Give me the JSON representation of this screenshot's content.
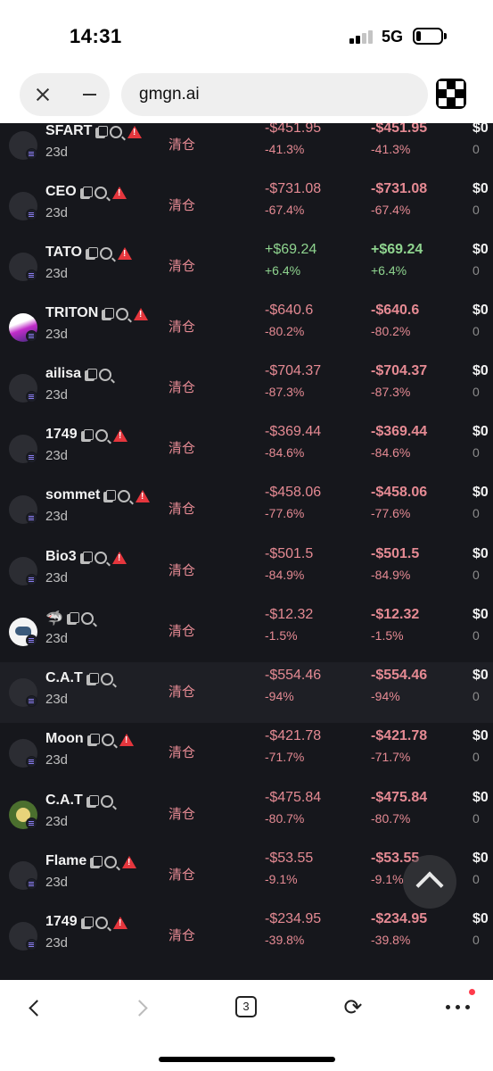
{
  "status_bar": {
    "time": "14:31",
    "network": "5G",
    "battery_level": 0.2
  },
  "browser": {
    "url": "gmgn.ai",
    "tab_count": "3"
  },
  "rows": [
    {
      "name": "SFART",
      "age": "23d",
      "type": "清仓",
      "pnl": "-$451.95",
      "pnl_pct": "-41.3%",
      "pnl2": "-$451.95",
      "pnl2_pct": "-41.3%",
      "extra": "$0",
      "extra_sub": "0",
      "warn": true,
      "avatar": "default"
    },
    {
      "name": "CEO",
      "age": "23d",
      "type": "清仓",
      "pnl": "-$731.08",
      "pnl_pct": "-67.4%",
      "pnl2": "-$731.08",
      "pnl2_pct": "-67.4%",
      "extra": "$0",
      "extra_sub": "0",
      "warn": true,
      "avatar": "default"
    },
    {
      "name": "TATO",
      "age": "23d",
      "type": "清仓",
      "pnl": "+$69.24",
      "pnl_pct": "+6.4%",
      "pnl2": "+$69.24",
      "pnl2_pct": "+6.4%",
      "extra": "$0",
      "extra_sub": "0",
      "warn": true,
      "avatar": "default",
      "positive": true
    },
    {
      "name": "TRITON",
      "age": "23d",
      "type": "清仓",
      "pnl": "-$640.6",
      "pnl_pct": "-80.2%",
      "pnl2": "-$640.6",
      "pnl2_pct": "-80.2%",
      "extra": "$0",
      "extra_sub": "0",
      "warn": true,
      "avatar": "triton"
    },
    {
      "name": "ailisa",
      "age": "23d",
      "type": "清仓",
      "pnl": "-$704.37",
      "pnl_pct": "-87.3%",
      "pnl2": "-$704.37",
      "pnl2_pct": "-87.3%",
      "extra": "$0",
      "extra_sub": "0",
      "warn": false,
      "avatar": "default"
    },
    {
      "name": "1749",
      "age": "23d",
      "type": "清仓",
      "pnl": "-$369.44",
      "pnl_pct": "-84.6%",
      "pnl2": "-$369.44",
      "pnl2_pct": "-84.6%",
      "extra": "$0",
      "extra_sub": "0",
      "warn": true,
      "avatar": "default"
    },
    {
      "name": "sommet",
      "age": "23d",
      "type": "清仓",
      "pnl": "-$458.06",
      "pnl_pct": "-77.6%",
      "pnl2": "-$458.06",
      "pnl2_pct": "-77.6%",
      "extra": "$0",
      "extra_sub": "0",
      "warn": true,
      "avatar": "default"
    },
    {
      "name": "Bio3",
      "age": "23d",
      "type": "清仓",
      "pnl": "-$501.5",
      "pnl_pct": "-84.9%",
      "pnl2": "-$501.5",
      "pnl2_pct": "-84.9%",
      "extra": "$0",
      "extra_sub": "0",
      "warn": true,
      "avatar": "default"
    },
    {
      "name": "🦈",
      "age": "23d",
      "type": "清仓",
      "pnl": "-$12.32",
      "pnl_pct": "-1.5%",
      "pnl2": "-$12.32",
      "pnl2_pct": "-1.5%",
      "extra": "$0",
      "extra_sub": "0",
      "warn": false,
      "avatar": "shark"
    },
    {
      "name": "C.A.T",
      "age": "23d",
      "type": "清仓",
      "pnl": "-$554.46",
      "pnl_pct": "-94%",
      "pnl2": "-$554.46",
      "pnl2_pct": "-94%",
      "extra": "$0",
      "extra_sub": "0",
      "warn": false,
      "avatar": "default",
      "highlight": true
    },
    {
      "name": "Moon",
      "age": "23d",
      "type": "清仓",
      "pnl": "-$421.78",
      "pnl_pct": "-71.7%",
      "pnl2": "-$421.78",
      "pnl2_pct": "-71.7%",
      "extra": "$0",
      "extra_sub": "0",
      "warn": true,
      "avatar": "default"
    },
    {
      "name": "C.A.T",
      "age": "23d",
      "type": "清仓",
      "pnl": "-$475.84",
      "pnl_pct": "-80.7%",
      "pnl2": "-$475.84",
      "pnl2_pct": "-80.7%",
      "extra": "$0",
      "extra_sub": "0",
      "warn": false,
      "avatar": "cat"
    },
    {
      "name": "Flame",
      "age": "23d",
      "type": "清仓",
      "pnl": "-$53.55",
      "pnl_pct": "-9.1%",
      "pnl2": "-$53.55",
      "pnl2_pct": "-9.1%",
      "extra": "$0",
      "extra_sub": "0",
      "warn": true,
      "avatar": "default"
    },
    {
      "name": "1749",
      "age": "23d",
      "type": "清仓",
      "pnl": "-$234.95",
      "pnl_pct": "-39.8%",
      "pnl2": "-$234.95",
      "pnl2_pct": "-39.8%",
      "extra": "$0",
      "extra_sub": "0",
      "warn": true,
      "avatar": "default"
    }
  ],
  "icons": {
    "close": "close-icon",
    "minimize": "minus-icon",
    "back": "chevron-left-icon",
    "forward": "chevron-right-icon",
    "refresh": "refresh-icon",
    "more": "more-dots-icon",
    "scroll_top": "chevron-up-icon"
  },
  "colors": {
    "loss": "#e58a93",
    "gain": "#8fd48f",
    "background": "#16171c"
  }
}
